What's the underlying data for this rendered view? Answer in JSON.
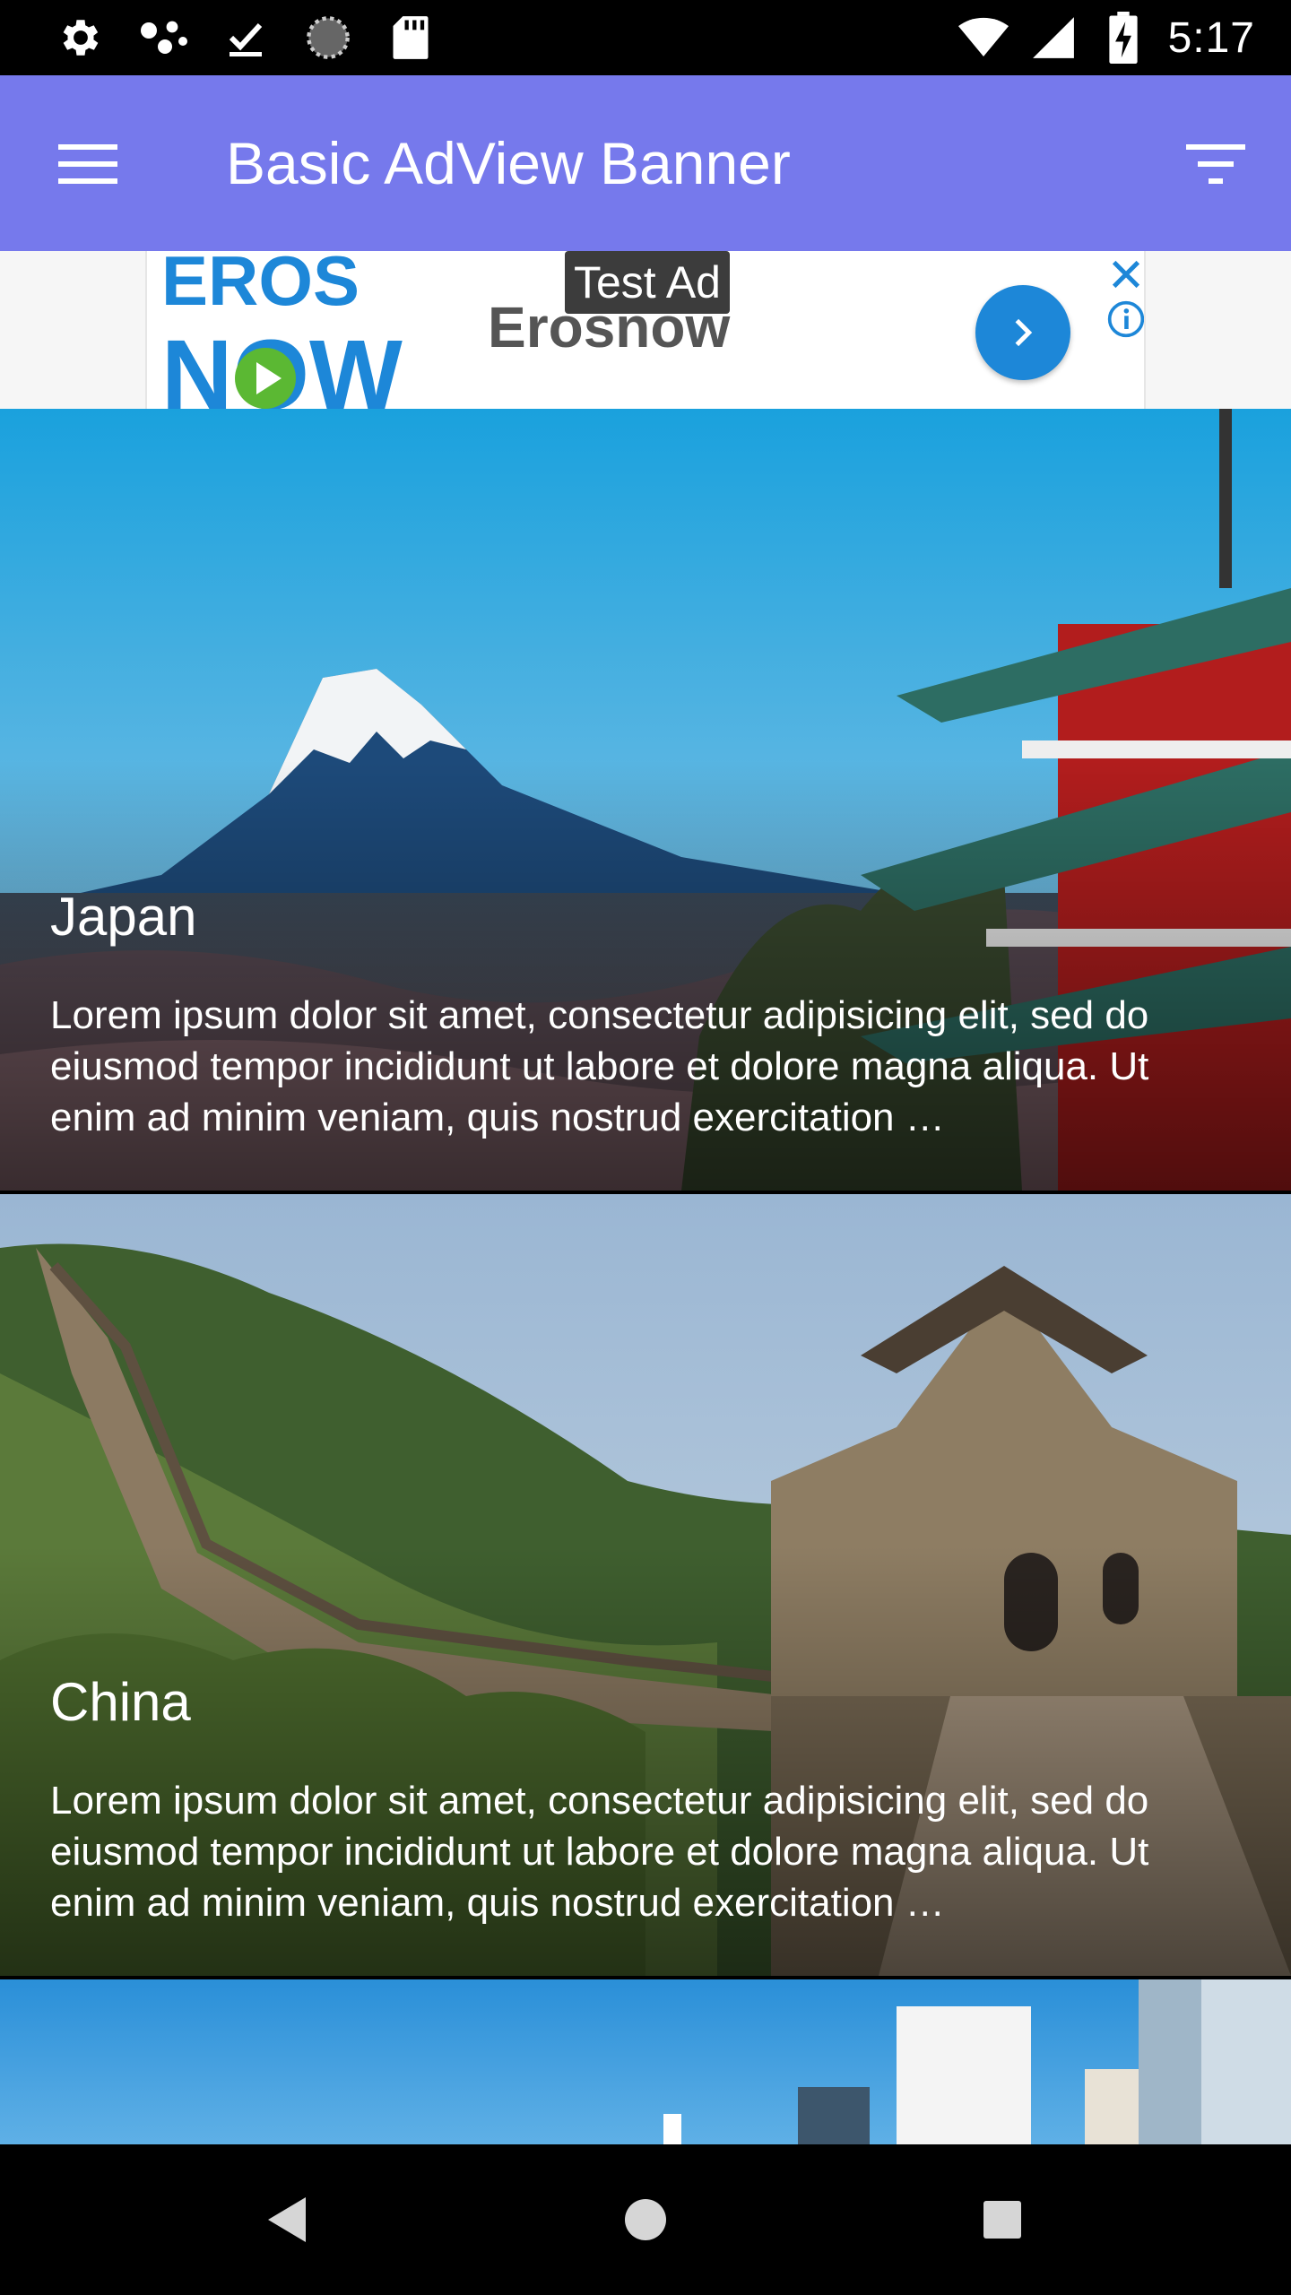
{
  "status_bar": {
    "time": "5:17",
    "icons": [
      "gear-icon",
      "hub-icon",
      "download-done-icon",
      "sync-circle-icon",
      "sd-card-icon",
      "wifi-icon",
      "signal-icon",
      "battery-charging-icon"
    ]
  },
  "app_bar": {
    "title": "Basic AdView Banner",
    "menu_icon": "hamburger-menu-icon",
    "filter_icon": "filter-icon",
    "color": "#7679ec"
  },
  "ad": {
    "label": "Test Ad",
    "advertiser": "Erosnow",
    "logo_text_top": "EROS",
    "logo_text_bottom": "NOW",
    "go_icon": "chevron-right-icon",
    "close_icon": "close-icon",
    "info_icon": "info-icon",
    "accent": "#1d87d8"
  },
  "cards": [
    {
      "title": "Japan",
      "text": "Lorem ipsum dolor sit amet, consectetur adipisicing elit, sed do eiusmod tempor incididunt ut labore et dolore magna aliqua. Ut enim ad minim veniam, quis nostrud exercitation …"
    },
    {
      "title": "China",
      "text": "Lorem ipsum dolor sit amet, consectetur adipisicing elit, sed do eiusmod tempor incididunt ut labore et dolore magna aliqua. Ut enim ad minim veniam, quis nostrud exercitation …"
    }
  ],
  "nav_bar": {
    "back_icon": "back-triangle-icon",
    "home_icon": "home-circle-icon",
    "recents_icon": "recents-square-icon"
  }
}
